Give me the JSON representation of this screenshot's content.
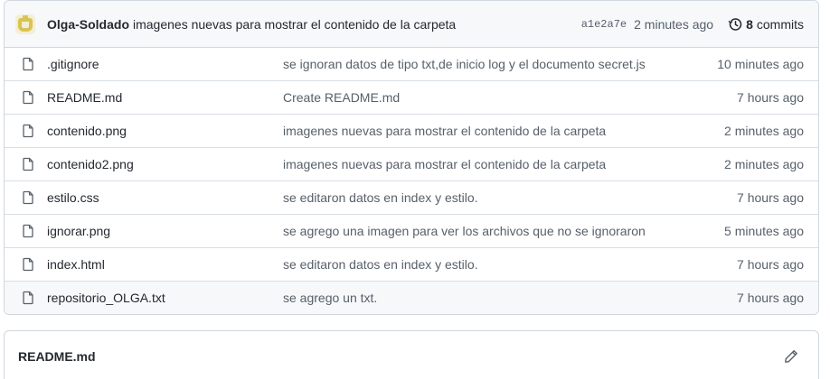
{
  "commit": {
    "author": "Olga-Soldado",
    "message": "imagenes nuevas para mostrar el contenido de la carpeta",
    "sha": "a1e2a7e",
    "time": "2 minutes ago",
    "count": "8",
    "count_label": "commits"
  },
  "files": [
    {
      "name": ".gitignore",
      "message": "se ignoran datos de tipo txt,de inicio log y el documento secret.js",
      "age": "10 minutes ago",
      "icon": "file-icon"
    },
    {
      "name": "README.md",
      "message": "Create README.md",
      "age": "7 hours ago",
      "icon": "file-icon"
    },
    {
      "name": "contenido.png",
      "message": "imagenes nuevas para mostrar el contenido de la carpeta",
      "age": "2 minutes ago",
      "icon": "file-icon"
    },
    {
      "name": "contenido2.png",
      "message": "imagenes nuevas para mostrar el contenido de la carpeta",
      "age": "2 minutes ago",
      "icon": "file-icon"
    },
    {
      "name": "estilo.css",
      "message": "se editaron datos en index y estilo.",
      "age": "7 hours ago",
      "icon": "file-icon"
    },
    {
      "name": "ignorar.png",
      "message": "se agrego una imagen para ver los archivos que no se ignoraron",
      "age": "5 minutes ago",
      "icon": "file-icon"
    },
    {
      "name": "index.html",
      "message": "se editaron datos en index y estilo.",
      "age": "7 hours ago",
      "icon": "file-icon"
    },
    {
      "name": "repositorio_OLGA.txt",
      "message": "se agrego un txt.",
      "age": "7 hours ago",
      "icon": "file-icon"
    }
  ],
  "readme": {
    "title": "README.md",
    "edit_icon": "pencil-icon"
  },
  "colors": {
    "border": "#d0d7de",
    "header_bg": "#f6f8fa",
    "muted_text": "#57606a",
    "text": "#24292f"
  }
}
